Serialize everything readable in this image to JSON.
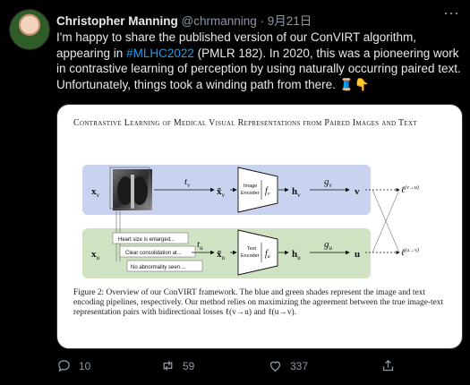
{
  "author": {
    "name": "Christopher Manning",
    "handle": "@chrmanning",
    "time": "· 9月21日"
  },
  "tweet": {
    "text_1": "I'm happy to share the published version of our ConVIRT algorithm, appearing in ",
    "hashtag": "#MLHC2022",
    "text_2": " (PMLR 182). In 2020, this was a pioneering work in contrastive learning of perception by using naturally occurring paired text. Unfortunately, things took a winding path from there. 🧵👇"
  },
  "figure": {
    "title": "Contrastive Learning of Medical Visual Representations from Paired Images and Text",
    "caption": "Figure 2: Overview of our ConVIRT framework. The blue and green shades represent the image and text encoding pipelines, respectively. Our method relies on maximizing the agreement between the true image-text representation pairs with bidirectional losses ℓ(v→u) and ℓ(u→v).",
    "image_row": {
      "xv": "xv",
      "tv": "tv",
      "xtilde_v": "x̃v",
      "encoder_label": "Image Encoder",
      "fv": "fv",
      "hv": "hv",
      "gv": "gv",
      "v": "v",
      "loss": "ℓ(v→u)"
    },
    "text_row": {
      "xu": "xu",
      "tu": "tu",
      "xtilde_u": "x̃u",
      "encoder_label": "Text Encoder",
      "fu": "fu",
      "hu": "hu",
      "gu": "gu",
      "u": "u",
      "loss": "ℓ(u→v)"
    },
    "sentences": [
      "Heart size is enlarged...",
      "Clear consolidation at...",
      "No abnormality seen ..."
    ]
  },
  "actions": {
    "replies": "10",
    "retweets": "59",
    "likes": "337"
  }
}
